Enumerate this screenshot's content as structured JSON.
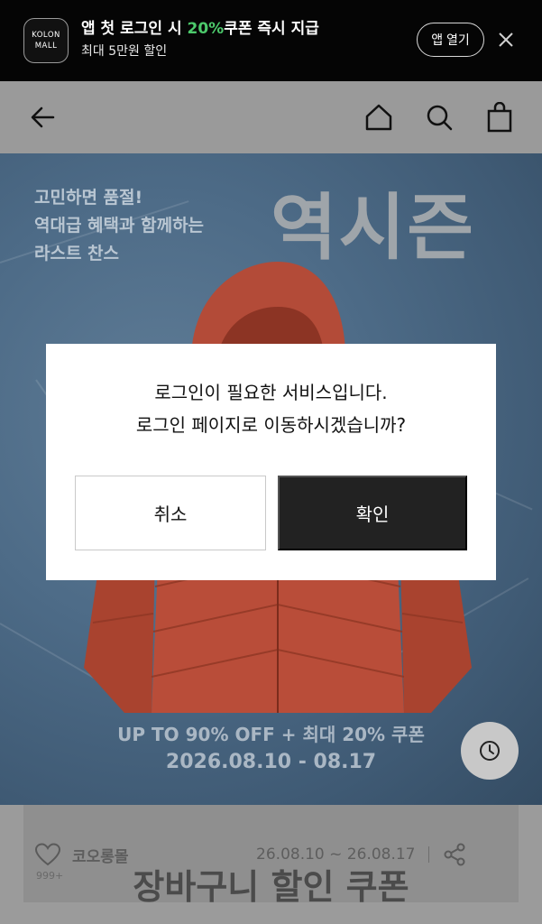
{
  "app_banner": {
    "logo_line1": "KOLON",
    "logo_line2": "MALL",
    "title_pre": "앱 첫 로그인 시 ",
    "title_highlight": "20%",
    "title_post": "쿠폰 즉시 지급",
    "subtitle": "최대 5만원 할인",
    "open_app_label": "앱 열기",
    "highlight_color": "#4cc96b"
  },
  "header": {
    "icons": [
      "back-arrow-icon",
      "home-icon",
      "search-icon",
      "shopping-bag-icon"
    ]
  },
  "hero": {
    "copy_line1": "고민하면 품절!",
    "copy_line2": "역대급 혜택과 함께하는",
    "copy_line3": "라스트 찬스",
    "title": "역시즌",
    "promo_line1": "UP TO 90% OFF + 최대 20% 쿠폰",
    "promo_line2": "2026.08.10 - 08.17"
  },
  "coupon_card": {
    "brand": "코오롱몰",
    "date_range": "26.08.10 ~ 26.08.17",
    "like_count": "999+",
    "title": "장바구니 할인 쿠폰"
  },
  "modal": {
    "message_line1": "로그인이 필요한 서비스입니다.",
    "message_line2": "로그인 페이지로 이동하시겠습니까?",
    "cancel_label": "취소",
    "confirm_label": "확인"
  }
}
